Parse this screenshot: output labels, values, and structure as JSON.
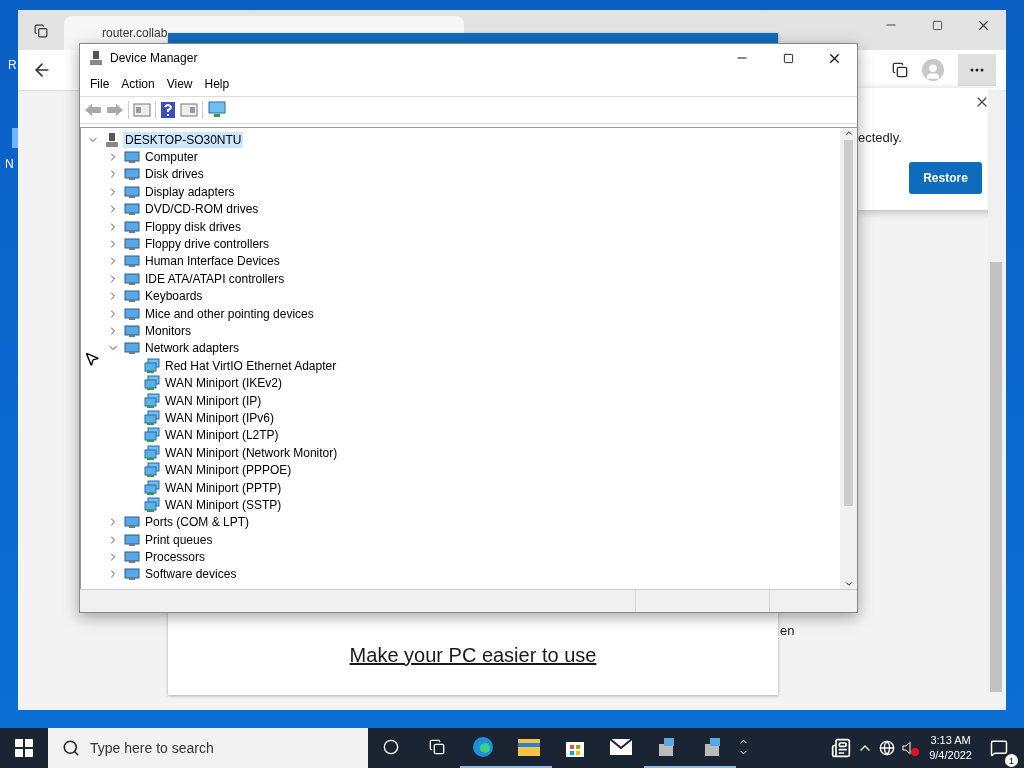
{
  "desktop": {
    "icon_labels": [
      "R",
      "N"
    ]
  },
  "browser": {
    "tab": {
      "title": "router.collab"
    },
    "content_text": "en",
    "notification": {
      "text": "ectedly.",
      "button": "Restore"
    }
  },
  "backdrop_window": {
    "link": "Make your PC easier to use"
  },
  "device_manager": {
    "title": "Device Manager",
    "menu": [
      "File",
      "Action",
      "View",
      "Help"
    ],
    "tree": [
      {
        "label": "DESKTOP-SO30NTU",
        "selected": true,
        "expanded": true,
        "children": [
          {
            "label": "Computer",
            "selected": false,
            "expanded": false
          },
          {
            "label": "Disk drives",
            "selected": false,
            "expanded": false
          },
          {
            "label": "Display adapters",
            "selected": false,
            "expanded": false
          },
          {
            "label": "DVD/CD-ROM drives",
            "selected": false,
            "expanded": false
          },
          {
            "label": "Floppy disk drives",
            "selected": false,
            "expanded": false
          },
          {
            "label": "Floppy drive controllers",
            "selected": false,
            "expanded": false
          },
          {
            "label": "Human Interface Devices",
            "selected": false,
            "expanded": false
          },
          {
            "label": "IDE ATA/ATAPI controllers",
            "selected": false,
            "expanded": false
          },
          {
            "label": "Keyboards",
            "selected": false,
            "expanded": false
          },
          {
            "label": "Mice and other pointing devices",
            "selected": false,
            "expanded": false
          },
          {
            "label": "Monitors",
            "selected": false,
            "expanded": false
          },
          {
            "label": "Network adapters",
            "selected": false,
            "expanded": true,
            "children": [
              {
                "label": "Red Hat VirtIO Ethernet Adapter",
                "selected": false
              },
              {
                "label": "WAN Miniport (IKEv2)",
                "selected": false
              },
              {
                "label": "WAN Miniport (IP)",
                "selected": false
              },
              {
                "label": "WAN Miniport (IPv6)",
                "selected": false
              },
              {
                "label": "WAN Miniport (L2TP)",
                "selected": false
              },
              {
                "label": "WAN Miniport (Network Monitor)",
                "selected": false
              },
              {
                "label": "WAN Miniport (PPPOE)",
                "selected": false
              },
              {
                "label": "WAN Miniport (PPTP)",
                "selected": false
              },
              {
                "label": "WAN Miniport (SSTP)",
                "selected": false
              }
            ]
          },
          {
            "label": "Ports (COM & LPT)",
            "selected": false,
            "expanded": false
          },
          {
            "label": "Print queues",
            "selected": false,
            "expanded": false
          },
          {
            "label": "Processors",
            "selected": false,
            "expanded": false
          },
          {
            "label": "Software devices",
            "selected": false,
            "expanded": false
          }
        ]
      }
    ]
  },
  "taskbar": {
    "search": {
      "placeholder": "Type here to search"
    },
    "apps": [
      {
        "kind": "edge",
        "running": true
      },
      {
        "kind": "explorer",
        "running": true
      },
      {
        "kind": "store",
        "running": false
      },
      {
        "kind": "mail",
        "running": false
      },
      {
        "kind": "device",
        "running": true
      },
      {
        "kind": "device",
        "running": true
      }
    ],
    "muted": true,
    "clock": {
      "time": "3:13 AM",
      "date": "9/4/2022"
    },
    "notifications": "1"
  }
}
